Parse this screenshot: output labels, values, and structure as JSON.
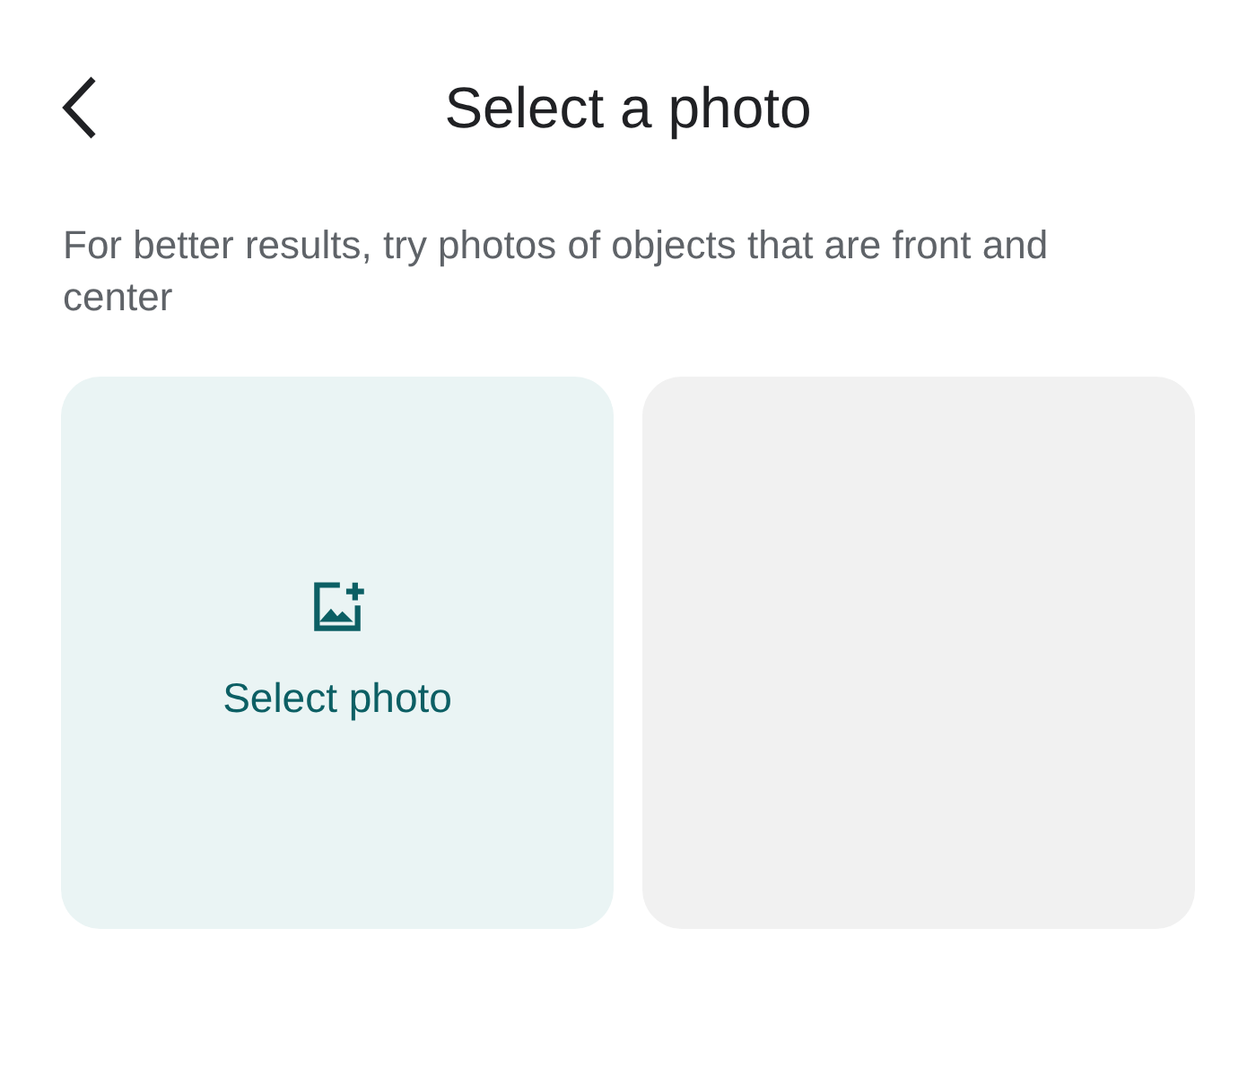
{
  "header": {
    "title": "Select a photo"
  },
  "description": "For better results, try photos of objects that are front and center",
  "tiles": [
    {
      "kind": "select",
      "label": "Select photo"
    },
    {
      "kind": "empty"
    }
  ]
}
